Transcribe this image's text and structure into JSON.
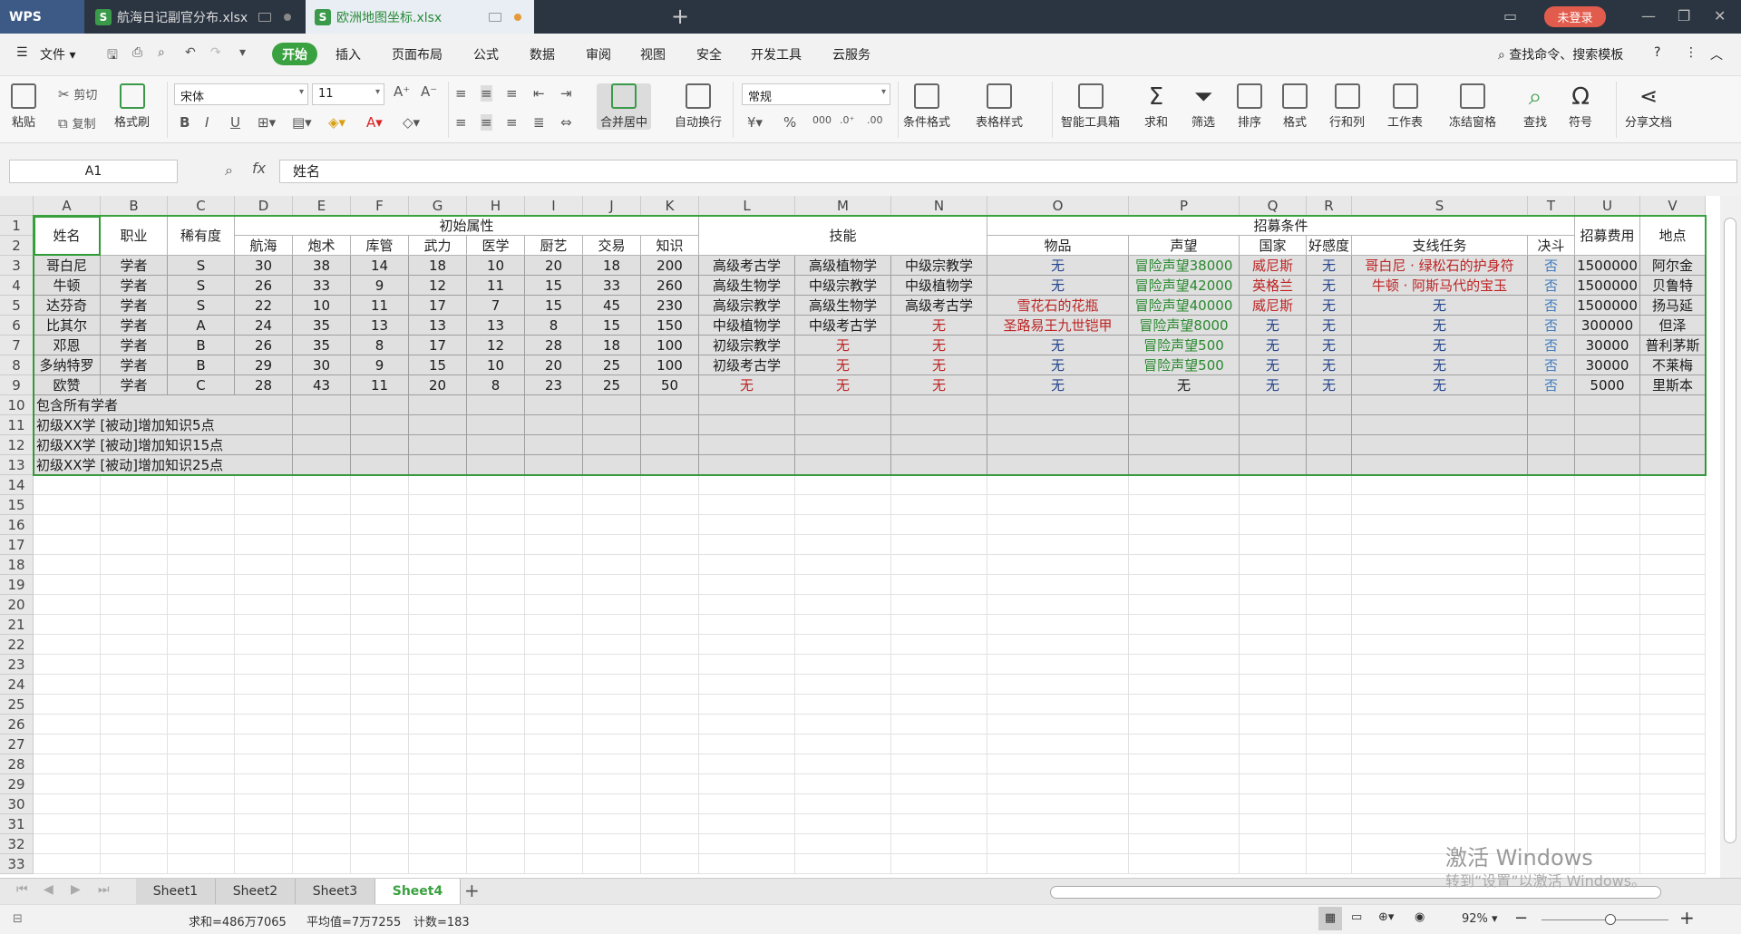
{
  "titlebar": {
    "logo": "WPS",
    "tabs": [
      {
        "label": "航海日记副官分布.xlsx",
        "active": false
      },
      {
        "label": "欧洲地图坐标.xlsx",
        "active": true
      }
    ],
    "new_tab": "+",
    "login": "未登录"
  },
  "menubar": {
    "file": "文件",
    "items": [
      "开始",
      "插入",
      "页面布局",
      "公式",
      "数据",
      "审阅",
      "视图",
      "安全",
      "开发工具",
      "云服务"
    ],
    "search": "查找命令、搜索模板"
  },
  "ribbon": {
    "paste": "粘贴",
    "cut": "剪切",
    "copy": "复制",
    "format_painter": "格式刷",
    "font": "宋体",
    "font_size": "11",
    "merge_center": "合并居中",
    "wrap": "自动换行",
    "number_format": "常规",
    "cond_format": "条件格式",
    "table_style": "表格样式",
    "smart_toolbox": "智能工具箱",
    "sum": "求和",
    "filter": "筛选",
    "sort": "排序",
    "format": "格式",
    "row_col": "行和列",
    "worksheet": "工作表",
    "freeze": "冻结窗格",
    "find": "查找",
    "symbol": "符号",
    "share": "分享文档"
  },
  "formula_bar": {
    "name_box": "A1",
    "fx": "fx",
    "content": "姓名"
  },
  "columns": [
    "A",
    "B",
    "C",
    "D",
    "E",
    "F",
    "G",
    "H",
    "I",
    "J",
    "K",
    "L",
    "M",
    "N",
    "O",
    "P",
    "Q",
    "R",
    "S",
    "T",
    "U",
    "V"
  ],
  "headers": {
    "name": "姓名",
    "job": "职业",
    "rarity": "稀有度",
    "initial_attrs": "初始属性",
    "attrs": [
      "航海",
      "炮术",
      "库管",
      "武力",
      "医学",
      "厨艺",
      "交易",
      "知识"
    ],
    "skills": "技能",
    "recruit_cond": "招募条件",
    "item": "物品",
    "fame": "声望",
    "country": "国家",
    "favor": "好感度",
    "sidequest": "支线任务",
    "duel": "决斗",
    "fee": "招募费用",
    "location": "地点"
  },
  "rows": [
    {
      "name": "哥白尼",
      "job": "学者",
      "rarity": "S",
      "attrs": [
        "30",
        "38",
        "14",
        "18",
        "10",
        "20",
        "18",
        "200"
      ],
      "skills": [
        "高级考古学",
        "高级植物学",
        "中级宗教学"
      ],
      "item": "无",
      "fame": "冒险声望38000",
      "country": "威尼斯",
      "favor": "无",
      "quest": "哥白尼 · 绿松石的护身符",
      "duel": "否",
      "fee": "1500000",
      "loc": "阿尔金"
    },
    {
      "name": "牛顿",
      "job": "学者",
      "rarity": "S",
      "attrs": [
        "26",
        "33",
        "9",
        "12",
        "11",
        "15",
        "33",
        "260"
      ],
      "skills": [
        "高级生物学",
        "中级宗教学",
        "中级植物学"
      ],
      "item": "无",
      "fame": "冒险声望42000",
      "country": "英格兰",
      "favor": "无",
      "quest": "牛顿 · 阿斯马代的宝玉",
      "duel": "否",
      "fee": "1500000",
      "loc": "贝鲁特"
    },
    {
      "name": "达芬奇",
      "job": "学者",
      "rarity": "S",
      "attrs": [
        "22",
        "10",
        "11",
        "17",
        "7",
        "15",
        "45",
        "230"
      ],
      "skills": [
        "高级宗教学",
        "高级生物学",
        "高级考古学"
      ],
      "item": "雪花石的花瓶",
      "fame": "冒险声望40000",
      "country": "威尼斯",
      "favor": "无",
      "quest": "无",
      "duel": "否",
      "fee": "1500000",
      "loc": "扬马延"
    },
    {
      "name": "比其尔",
      "job": "学者",
      "rarity": "A",
      "attrs": [
        "24",
        "35",
        "13",
        "13",
        "13",
        "8",
        "15",
        "150"
      ],
      "skills": [
        "中级植物学",
        "中级考古学",
        "无"
      ],
      "item": "圣路易王九世铠甲",
      "fame": "冒险声望8000",
      "country": "无",
      "favor": "无",
      "quest": "无",
      "duel": "否",
      "fee": "300000",
      "loc": "但泽"
    },
    {
      "name": "邓恩",
      "job": "学者",
      "rarity": "B",
      "attrs": [
        "26",
        "35",
        "8",
        "17",
        "12",
        "28",
        "18",
        "100"
      ],
      "skills": [
        "初级宗教学",
        "无",
        "无"
      ],
      "item": "无",
      "fame": "冒险声望500",
      "country": "无",
      "favor": "无",
      "quest": "无",
      "duel": "否",
      "fee": "30000",
      "loc": "普利茅斯"
    },
    {
      "name": "多纳特罗",
      "job": "学者",
      "rarity": "B",
      "attrs": [
        "29",
        "30",
        "9",
        "15",
        "10",
        "20",
        "25",
        "100"
      ],
      "skills": [
        "初级考古学",
        "无",
        "无"
      ],
      "item": "无",
      "fame": "冒险声望500",
      "country": "无",
      "favor": "无",
      "quest": "无",
      "duel": "否",
      "fee": "30000",
      "loc": "不莱梅"
    },
    {
      "name": "欧赞",
      "job": "学者",
      "rarity": "C",
      "attrs": [
        "28",
        "43",
        "11",
        "20",
        "8",
        "23",
        "25",
        "50"
      ],
      "skills": [
        "无",
        "无",
        "无"
      ],
      "item": "无",
      "fame": "无",
      "country": "无",
      "favor": "无",
      "quest": "无",
      "duel": "否",
      "fee": "5000",
      "loc": "里斯本"
    }
  ],
  "notes": [
    "包含所有学者",
    "初级XX学 [被动]增加知识5点",
    "初级XX学 [被动]增加知识15点",
    "初级XX学 [被动]增加知识25点"
  ],
  "sheet_tabs": [
    "Sheet1",
    "Sheet2",
    "Sheet3",
    "Sheet4"
  ],
  "active_sheet": "Sheet4",
  "status": {
    "sum": "求和=486万7065",
    "avg": "平均值=7万7255",
    "count": "计数=183",
    "zoom": "92%"
  },
  "watermark": {
    "line1": "激活 Windows",
    "line2": "转到“设置”以激活 Windows。"
  },
  "colors": {
    "accent": "#3aa140",
    "red": "#d82828",
    "green": "#2e9c35",
    "blue": "#2a4fa0"
  }
}
